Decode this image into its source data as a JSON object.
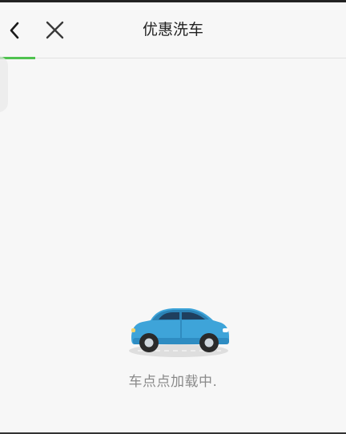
{
  "header": {
    "title": "优惠洗车",
    "back_icon": "chevron-left-icon",
    "close_icon": "close-icon"
  },
  "loading": {
    "text": "车点点加载中.",
    "illustration": "car-icon"
  },
  "colors": {
    "accent": "#4fc24f",
    "car_body": "#3ea4d9",
    "background": "#f7f7f7",
    "text_secondary": "#8a8a8a"
  }
}
